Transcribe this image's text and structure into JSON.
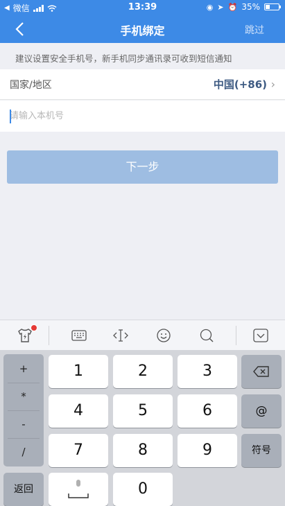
{
  "status_bar": {
    "carrier": "微信",
    "time": "13:39",
    "battery": "35%"
  },
  "nav": {
    "title": "手机绑定",
    "skip_label": "跳过"
  },
  "tip": "建议设置安全手机号，新手机同步通讯录可收到短信通知",
  "country": {
    "label": "国家/地区",
    "value": "中国(+86)"
  },
  "phone": {
    "placeholder": "请输入本机号"
  },
  "next_label": "下一步",
  "keyboard": {
    "symbols": [
      "+",
      "*",
      "-",
      "/"
    ],
    "keys": [
      "1",
      "2",
      "3",
      "4",
      "5",
      "6",
      "7",
      "8",
      "9"
    ],
    "at": "@",
    "fuhao": "符号",
    "fanhui": "返回",
    "zero": "0"
  },
  "colors": {
    "primary": "#3d8ae6",
    "button_disabled": "#9ebde2"
  }
}
